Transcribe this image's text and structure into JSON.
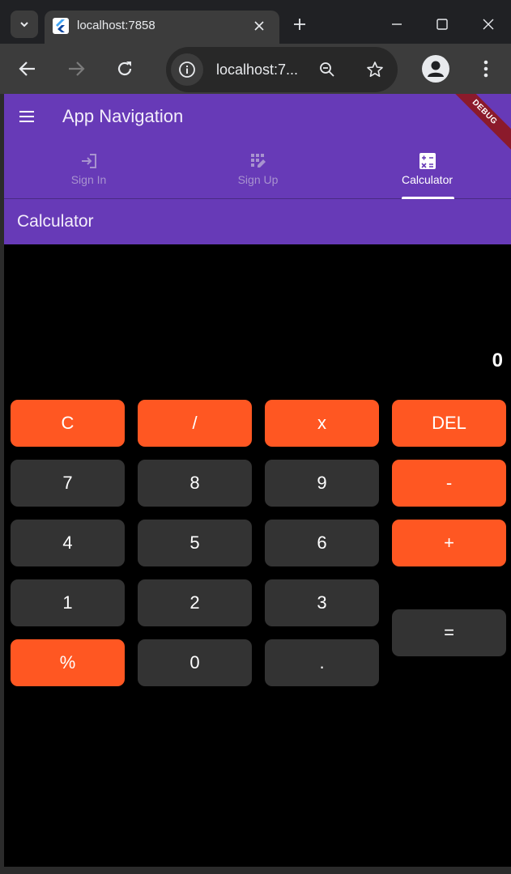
{
  "browser": {
    "tab_title": "localhost:7858",
    "url": "localhost:7...",
    "icons": [
      "tab-search-icon",
      "flutter-favicon",
      "close-icon",
      "plus-icon",
      "minimize-icon",
      "maximize-icon",
      "window-close-icon",
      "back-arrow-icon",
      "forward-arrow-icon",
      "reload-icon",
      "site-info-icon",
      "zoom-icon",
      "star-icon",
      "profile-icon",
      "more-vert-icon"
    ]
  },
  "app": {
    "title": "App Navigation",
    "debug_banner": "DEBUG",
    "tabs": [
      {
        "label": "Sign In",
        "icon": "login-icon",
        "active": false
      },
      {
        "label": "Sign Up",
        "icon": "app-registration-icon",
        "active": false
      },
      {
        "label": "Calculator",
        "icon": "calculate-icon",
        "active": true
      }
    ],
    "page_title": "Calculator",
    "display_value": "0",
    "keys": [
      {
        "label": "C",
        "kind": "operator"
      },
      {
        "label": "/",
        "kind": "operator"
      },
      {
        "label": "x",
        "kind": "operator"
      },
      {
        "label": "DEL",
        "kind": "operator"
      },
      {
        "label": "7",
        "kind": "number"
      },
      {
        "label": "8",
        "kind": "number"
      },
      {
        "label": "9",
        "kind": "number"
      },
      {
        "label": "-",
        "kind": "operator"
      },
      {
        "label": "4",
        "kind": "number"
      },
      {
        "label": "5",
        "kind": "number"
      },
      {
        "label": "6",
        "kind": "number"
      },
      {
        "label": "+",
        "kind": "operator"
      },
      {
        "label": "1",
        "kind": "number"
      },
      {
        "label": "2",
        "kind": "number"
      },
      {
        "label": "3",
        "kind": "number"
      },
      {
        "label": "=",
        "kind": "equals"
      },
      {
        "label": "%",
        "kind": "operator"
      },
      {
        "label": "0",
        "kind": "number"
      },
      {
        "label": ".",
        "kind": "number"
      }
    ]
  },
  "colors": {
    "app_bar": "#673ab7",
    "operator_key": "#ff5722",
    "number_key": "#333333",
    "background": "#000000"
  }
}
